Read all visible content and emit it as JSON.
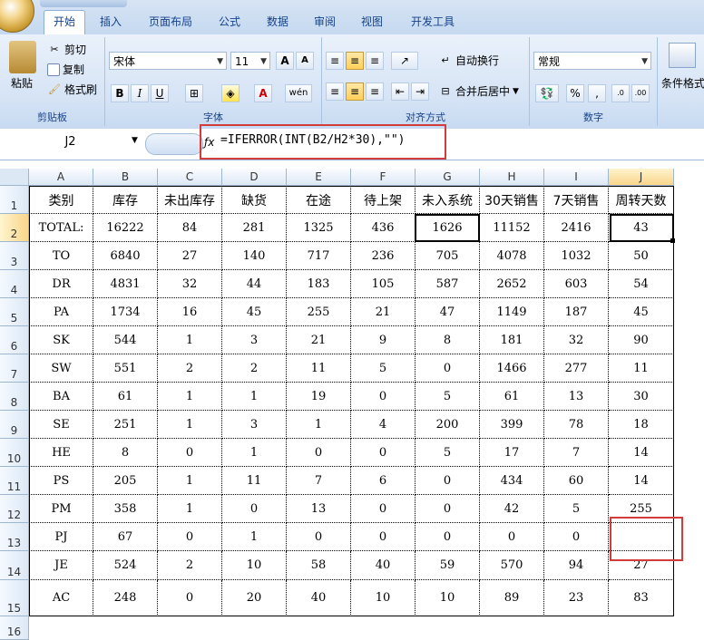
{
  "ribbon": {
    "tabs": [
      "开始",
      "插入",
      "页面布局",
      "公式",
      "数据",
      "审阅",
      "视图",
      "开发工具"
    ],
    "clipboard": {
      "paste": "粘贴",
      "cut": "剪切",
      "copy": "复制",
      "format_painter": "格式刷",
      "label": "剪贴板"
    },
    "font": {
      "name": "宋体",
      "size": "11",
      "label": "字体"
    },
    "alignment": {
      "wrap": "自动换行",
      "merge": "合并后居中",
      "label": "对齐方式"
    },
    "number": {
      "format": "常规",
      "label": "数字",
      "percent": "%",
      "comma": ","
    },
    "styles": {
      "conditional": "条件格式"
    }
  },
  "formula_bar": {
    "name_box": "J2",
    "formula": "=IFERROR(INT(B2/H2*30),\"\")"
  },
  "sheet": {
    "columns": [
      "A",
      "B",
      "C",
      "D",
      "E",
      "F",
      "G",
      "H",
      "I",
      "J"
    ],
    "row_numbers": [
      "1",
      "2",
      "3",
      "4",
      "5",
      "6",
      "7",
      "8",
      "9",
      "10",
      "11",
      "12",
      "13",
      "14",
      "15",
      "16"
    ],
    "header": [
      "类别",
      "库存",
      "未出库存",
      "缺货",
      "在途",
      "待上架",
      "未入系统",
      "30天销售",
      "7天销售",
      "周转天数"
    ],
    "rows": [
      [
        "TOTAL:",
        "16222",
        "84",
        "281",
        "1325",
        "436",
        "1626",
        "11152",
        "2416",
        "43"
      ],
      [
        "TO",
        "6840",
        "27",
        "140",
        "717",
        "236",
        "705",
        "4078",
        "1032",
        "50"
      ],
      [
        "DR",
        "4831",
        "32",
        "44",
        "183",
        "105",
        "587",
        "2652",
        "603",
        "54"
      ],
      [
        "PA",
        "1734",
        "16",
        "45",
        "255",
        "21",
        "47",
        "1149",
        "187",
        "45"
      ],
      [
        "SK",
        "544",
        "1",
        "3",
        "21",
        "9",
        "8",
        "181",
        "32",
        "90"
      ],
      [
        "SW",
        "551",
        "2",
        "2",
        "11",
        "5",
        "0",
        "1466",
        "277",
        "11"
      ],
      [
        "BA",
        "61",
        "1",
        "1",
        "19",
        "0",
        "5",
        "61",
        "13",
        "30"
      ],
      [
        "SE",
        "251",
        "1",
        "3",
        "1",
        "4",
        "200",
        "399",
        "78",
        "18"
      ],
      [
        "HE",
        "8",
        "0",
        "1",
        "0",
        "0",
        "5",
        "17",
        "7",
        "14"
      ],
      [
        "PS",
        "205",
        "1",
        "11",
        "7",
        "6",
        "0",
        "434",
        "60",
        "14"
      ],
      [
        "PM",
        "358",
        "1",
        "0",
        "13",
        "0",
        "0",
        "42",
        "5",
        "255"
      ],
      [
        "PJ",
        "67",
        "0",
        "1",
        "0",
        "0",
        "0",
        "0",
        "0",
        ""
      ],
      [
        "JE",
        "524",
        "2",
        "10",
        "58",
        "40",
        "59",
        "570",
        "94",
        "27"
      ],
      [
        "AC",
        "248",
        "0",
        "20",
        "40",
        "10",
        "10",
        "89",
        "23",
        "83"
      ]
    ]
  },
  "colors": {
    "ribbon_text": "#15428b",
    "highlight_red": "#d23c3c",
    "selected_header": "#f9d58a"
  }
}
